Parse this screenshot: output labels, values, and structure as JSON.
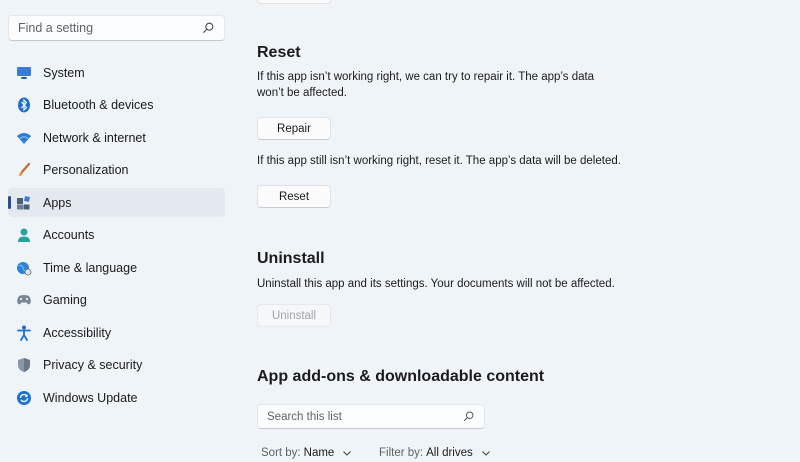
{
  "sidebar": {
    "search_placeholder": "Find a setting",
    "items": [
      {
        "label": "System",
        "icon": "monitor-icon"
      },
      {
        "label": "Bluetooth & devices",
        "icon": "bluetooth-icon"
      },
      {
        "label": "Network & internet",
        "icon": "wifi-icon"
      },
      {
        "label": "Personalization",
        "icon": "brush-icon"
      },
      {
        "label": "Apps",
        "icon": "apps-icon",
        "selected": true
      },
      {
        "label": "Accounts",
        "icon": "person-icon"
      },
      {
        "label": "Time & language",
        "icon": "globe-clock-icon"
      },
      {
        "label": "Gaming",
        "icon": "gamepad-icon"
      },
      {
        "label": "Accessibility",
        "icon": "accessibility-icon"
      },
      {
        "label": "Privacy & security",
        "icon": "shield-icon"
      },
      {
        "label": "Windows Update",
        "icon": "update-icon"
      }
    ]
  },
  "reset_section": {
    "title": "Reset",
    "repair_description": "If this app isn’t working right, we can try to repair it. The app’s data",
    "repair_description_line2": "won’t be affected.",
    "repair_button": "Repair",
    "reset_description": "If this app still isn’t working right, reset it. The app’s data will be deleted.",
    "reset_button": "Reset"
  },
  "uninstall_section": {
    "title": "Uninstall",
    "description": "Uninstall this app and its settings. Your documents will not be affected.",
    "button": "Uninstall"
  },
  "addons_section": {
    "title": "App add-ons & downloadable content",
    "search_placeholder": "Search this list",
    "sort_label": "Sort by:",
    "sort_value": "Name",
    "filter_label": "Filter by:",
    "filter_value": "All drives"
  },
  "colors": {
    "background": "#eff4f9",
    "accent": "#2a4d8f"
  }
}
